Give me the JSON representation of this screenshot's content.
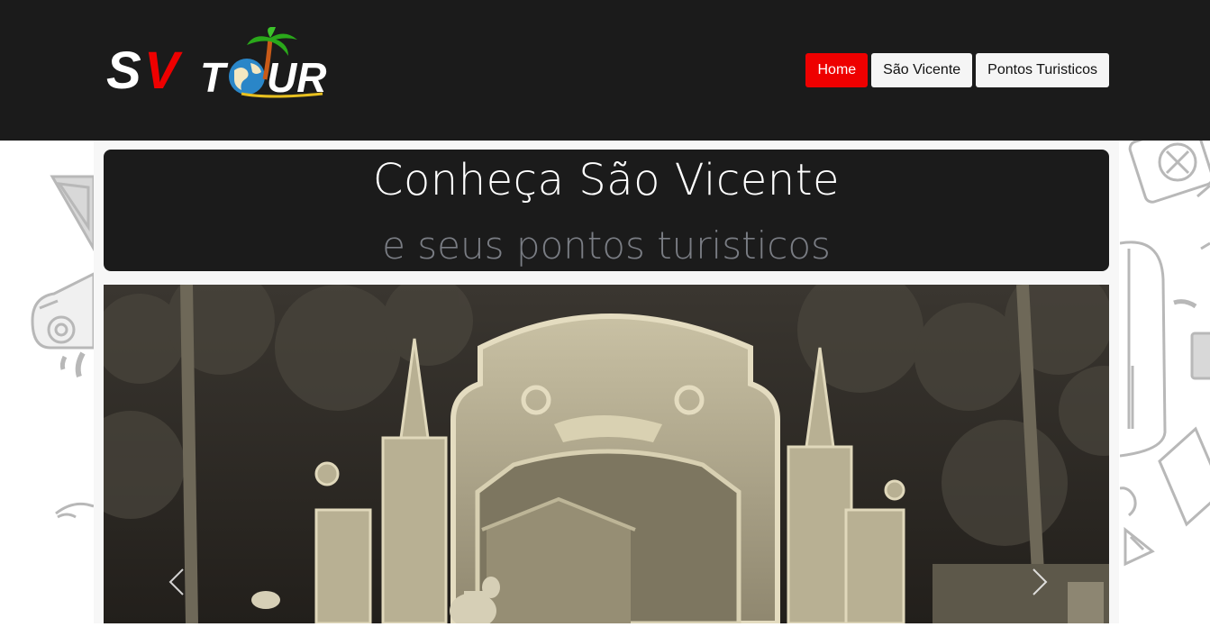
{
  "header": {
    "logo": {
      "text_sv": "SV",
      "text_tour": "TOUR"
    },
    "nav": [
      {
        "label": "Home",
        "active": true
      },
      {
        "label": "São Vicente",
        "active": false
      },
      {
        "label": "Pontos Turisticos",
        "active": false
      }
    ]
  },
  "hero": {
    "title": "Conheça São Vicente",
    "subtitle": "e seus pontos turisticos"
  },
  "carousel": {
    "image_icon": "vintage-monument-photo",
    "prev_icon": "chevron-left-icon",
    "next_icon": "chevron-right-icon"
  },
  "colors": {
    "header_bg": "#1b1b1b",
    "accent": "#ee0000",
    "subtitle": "#7a7d84"
  }
}
